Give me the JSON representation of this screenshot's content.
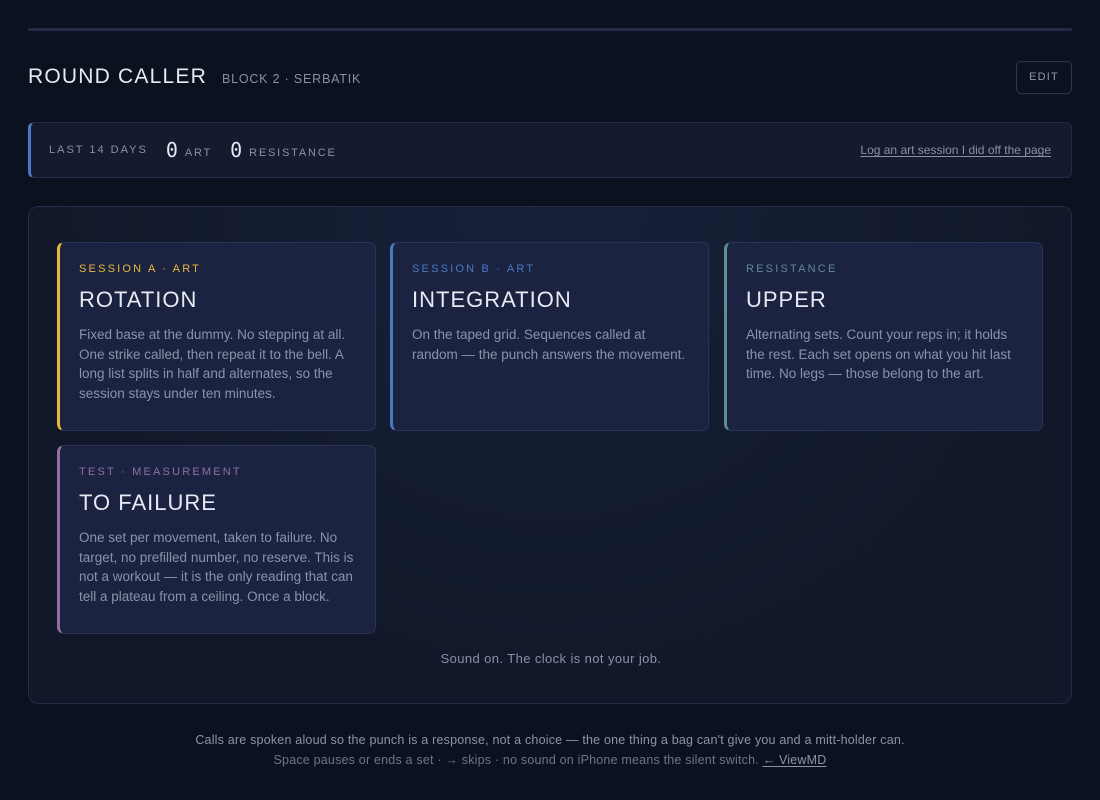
{
  "header": {
    "title": "ROUND CALLER",
    "subtitle": "BLOCK 2 · SERBATIK",
    "edit_label": "EDIT"
  },
  "stats": {
    "label": "LAST 14 DAYS",
    "art_count": "0",
    "art_label": "ART",
    "resistance_count": "0",
    "resistance_label": "RESISTANCE",
    "log_link": "Log an art session I did off the page"
  },
  "cards": [
    {
      "tag": "SESSION A · ART",
      "title": "ROTATION",
      "description": "Fixed base at the dummy. No stepping at all. One strike called, then repeat it to the bell. A long list splits in half and alternates, so the session stays under ten minutes.",
      "accent": "#e8b93a"
    },
    {
      "tag": "SESSION B · ART",
      "title": "INTEGRATION",
      "description": "On the taped grid. Sequences called at random — the punch answers the movement.",
      "accent": "#4a78c4"
    },
    {
      "tag": "RESISTANCE",
      "title": "UPPER",
      "description": "Alternating sets. Count your reps in; it holds the rest. Each set opens on what you hit last time. No legs — those belong to the art.",
      "accent": "#5f8c96"
    },
    {
      "tag": "TEST · MEASUREMENT",
      "title": "TO FAILURE",
      "description": "One set per movement, taken to failure. No target, no prefilled number, no reserve. This is not a workout — it is the only reading that can tell a plateau from a ceiling. Once a block.",
      "accent": "#8d6fa8"
    }
  ],
  "panel": {
    "footnote": "Sound on. The clock is not your job."
  },
  "footer": {
    "line1": "Calls are spoken aloud so the punch is a response, not a choice — the one thing a bag can't give you and a mitt-holder can.",
    "line2": "Space pauses or ends a set · → skips · no sound on iPhone means the silent switch.",
    "link": "← ViewMD"
  },
  "colors": {
    "background": "#0c1120",
    "panel": "#111829",
    "card": "#1b2340",
    "stats_accent": "#4a78c4"
  }
}
